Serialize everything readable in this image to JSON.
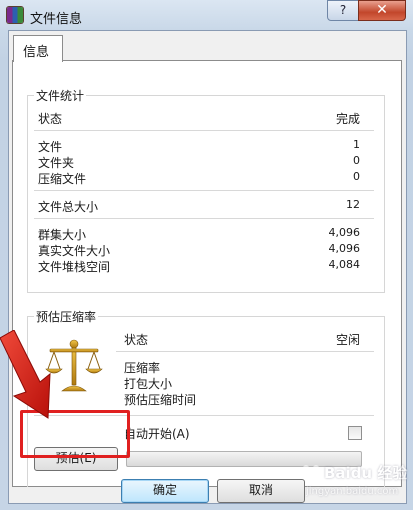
{
  "window": {
    "title": "文件信息",
    "help_label": "?",
    "close_label": "✕"
  },
  "tab": {
    "label": "信息"
  },
  "file_stats": {
    "title": "文件统计",
    "status_label": "状态",
    "status_value": "完成",
    "rows": [
      {
        "label": "文件",
        "value": "1"
      },
      {
        "label": "文件夹",
        "value": "0"
      },
      {
        "label": "压缩文件",
        "value": "0"
      }
    ],
    "total_label": "文件总大小",
    "total_value": "12",
    "sizes": [
      {
        "label": "群集大小",
        "value": "4,096"
      },
      {
        "label": "真实文件大小",
        "value": "4,096"
      },
      {
        "label": "文件堆栈空间",
        "value": "4,084"
      }
    ]
  },
  "estimate": {
    "title": "预估压缩率",
    "status_label": "状态",
    "status_value": "空闲",
    "items": [
      "压缩率",
      "打包大小",
      "预估压缩时间"
    ],
    "auto_start_label": "自动开始(A)",
    "auto_start_checked": false,
    "estimate_button": "预估(E)",
    "progress": 0
  },
  "footer": {
    "ok_label": "确定",
    "cancel_label": "取消"
  },
  "watermark": {
    "text": "Baidu 经验",
    "subtext": "jingyan.baidu.com"
  },
  "colors": {
    "highlight": "#e02020",
    "title_bar": "#c9d8e8",
    "close_button": "#c2462b"
  },
  "icons": {
    "app": "winrar-books-icon",
    "scales": "scales-icon",
    "arrow": "red-arrow-icon"
  }
}
